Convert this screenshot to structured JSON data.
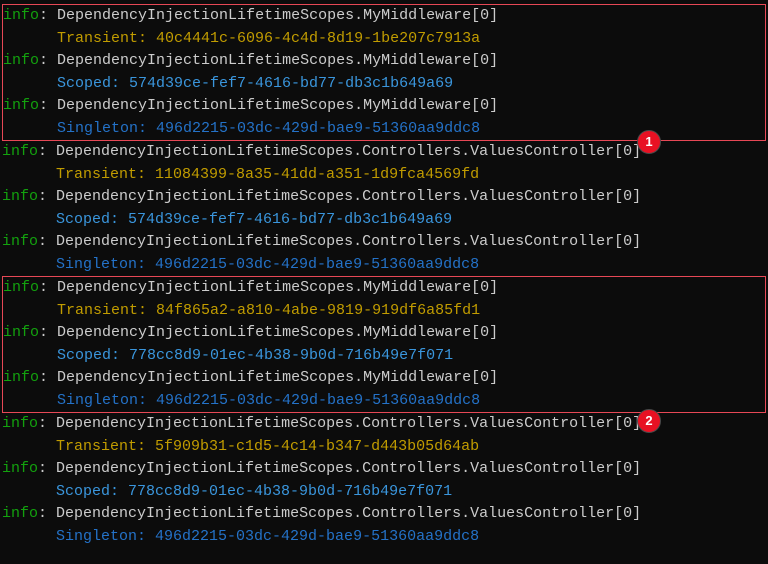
{
  "labels": {
    "info": "info",
    "transient": "Transient:",
    "scoped": "Scoped:",
    "singleton": "Singleton:"
  },
  "sources": {
    "middleware": "DependencyInjectionLifetimeScopes.MyMiddleware[0]",
    "controller": "DependencyInjectionLifetimeScopes.Controllers.ValuesController[0]"
  },
  "guids": {
    "block1": {
      "transient": "40c4441c-6096-4c4d-8d19-1be207c7913a",
      "scoped": "574d39ce-fef7-4616-bd77-db3c1b649a69",
      "singleton": "496d2215-03dc-429d-bae9-51360aa9ddc8"
    },
    "block2": {
      "transient": "11084399-8a35-41dd-a351-1d9fca4569fd",
      "scoped": "574d39ce-fef7-4616-bd77-db3c1b649a69",
      "singleton": "496d2215-03dc-429d-bae9-51360aa9ddc8"
    },
    "block3": {
      "transient": "84f865a2-a810-4abe-9819-919df6a85fd1",
      "scoped": "778cc8d9-01ec-4b38-9b0d-716b49e7f071",
      "singleton": "496d2215-03dc-429d-bae9-51360aa9ddc8"
    },
    "block4": {
      "transient": "5f909b31-c1d5-4c14-b347-d443b05d64ab",
      "scoped": "778cc8d9-01ec-4b38-9b0d-716b49e7f071",
      "singleton": "496d2215-03dc-429d-bae9-51360aa9ddc8"
    }
  },
  "badges": {
    "b1": "1",
    "b2": "2"
  }
}
